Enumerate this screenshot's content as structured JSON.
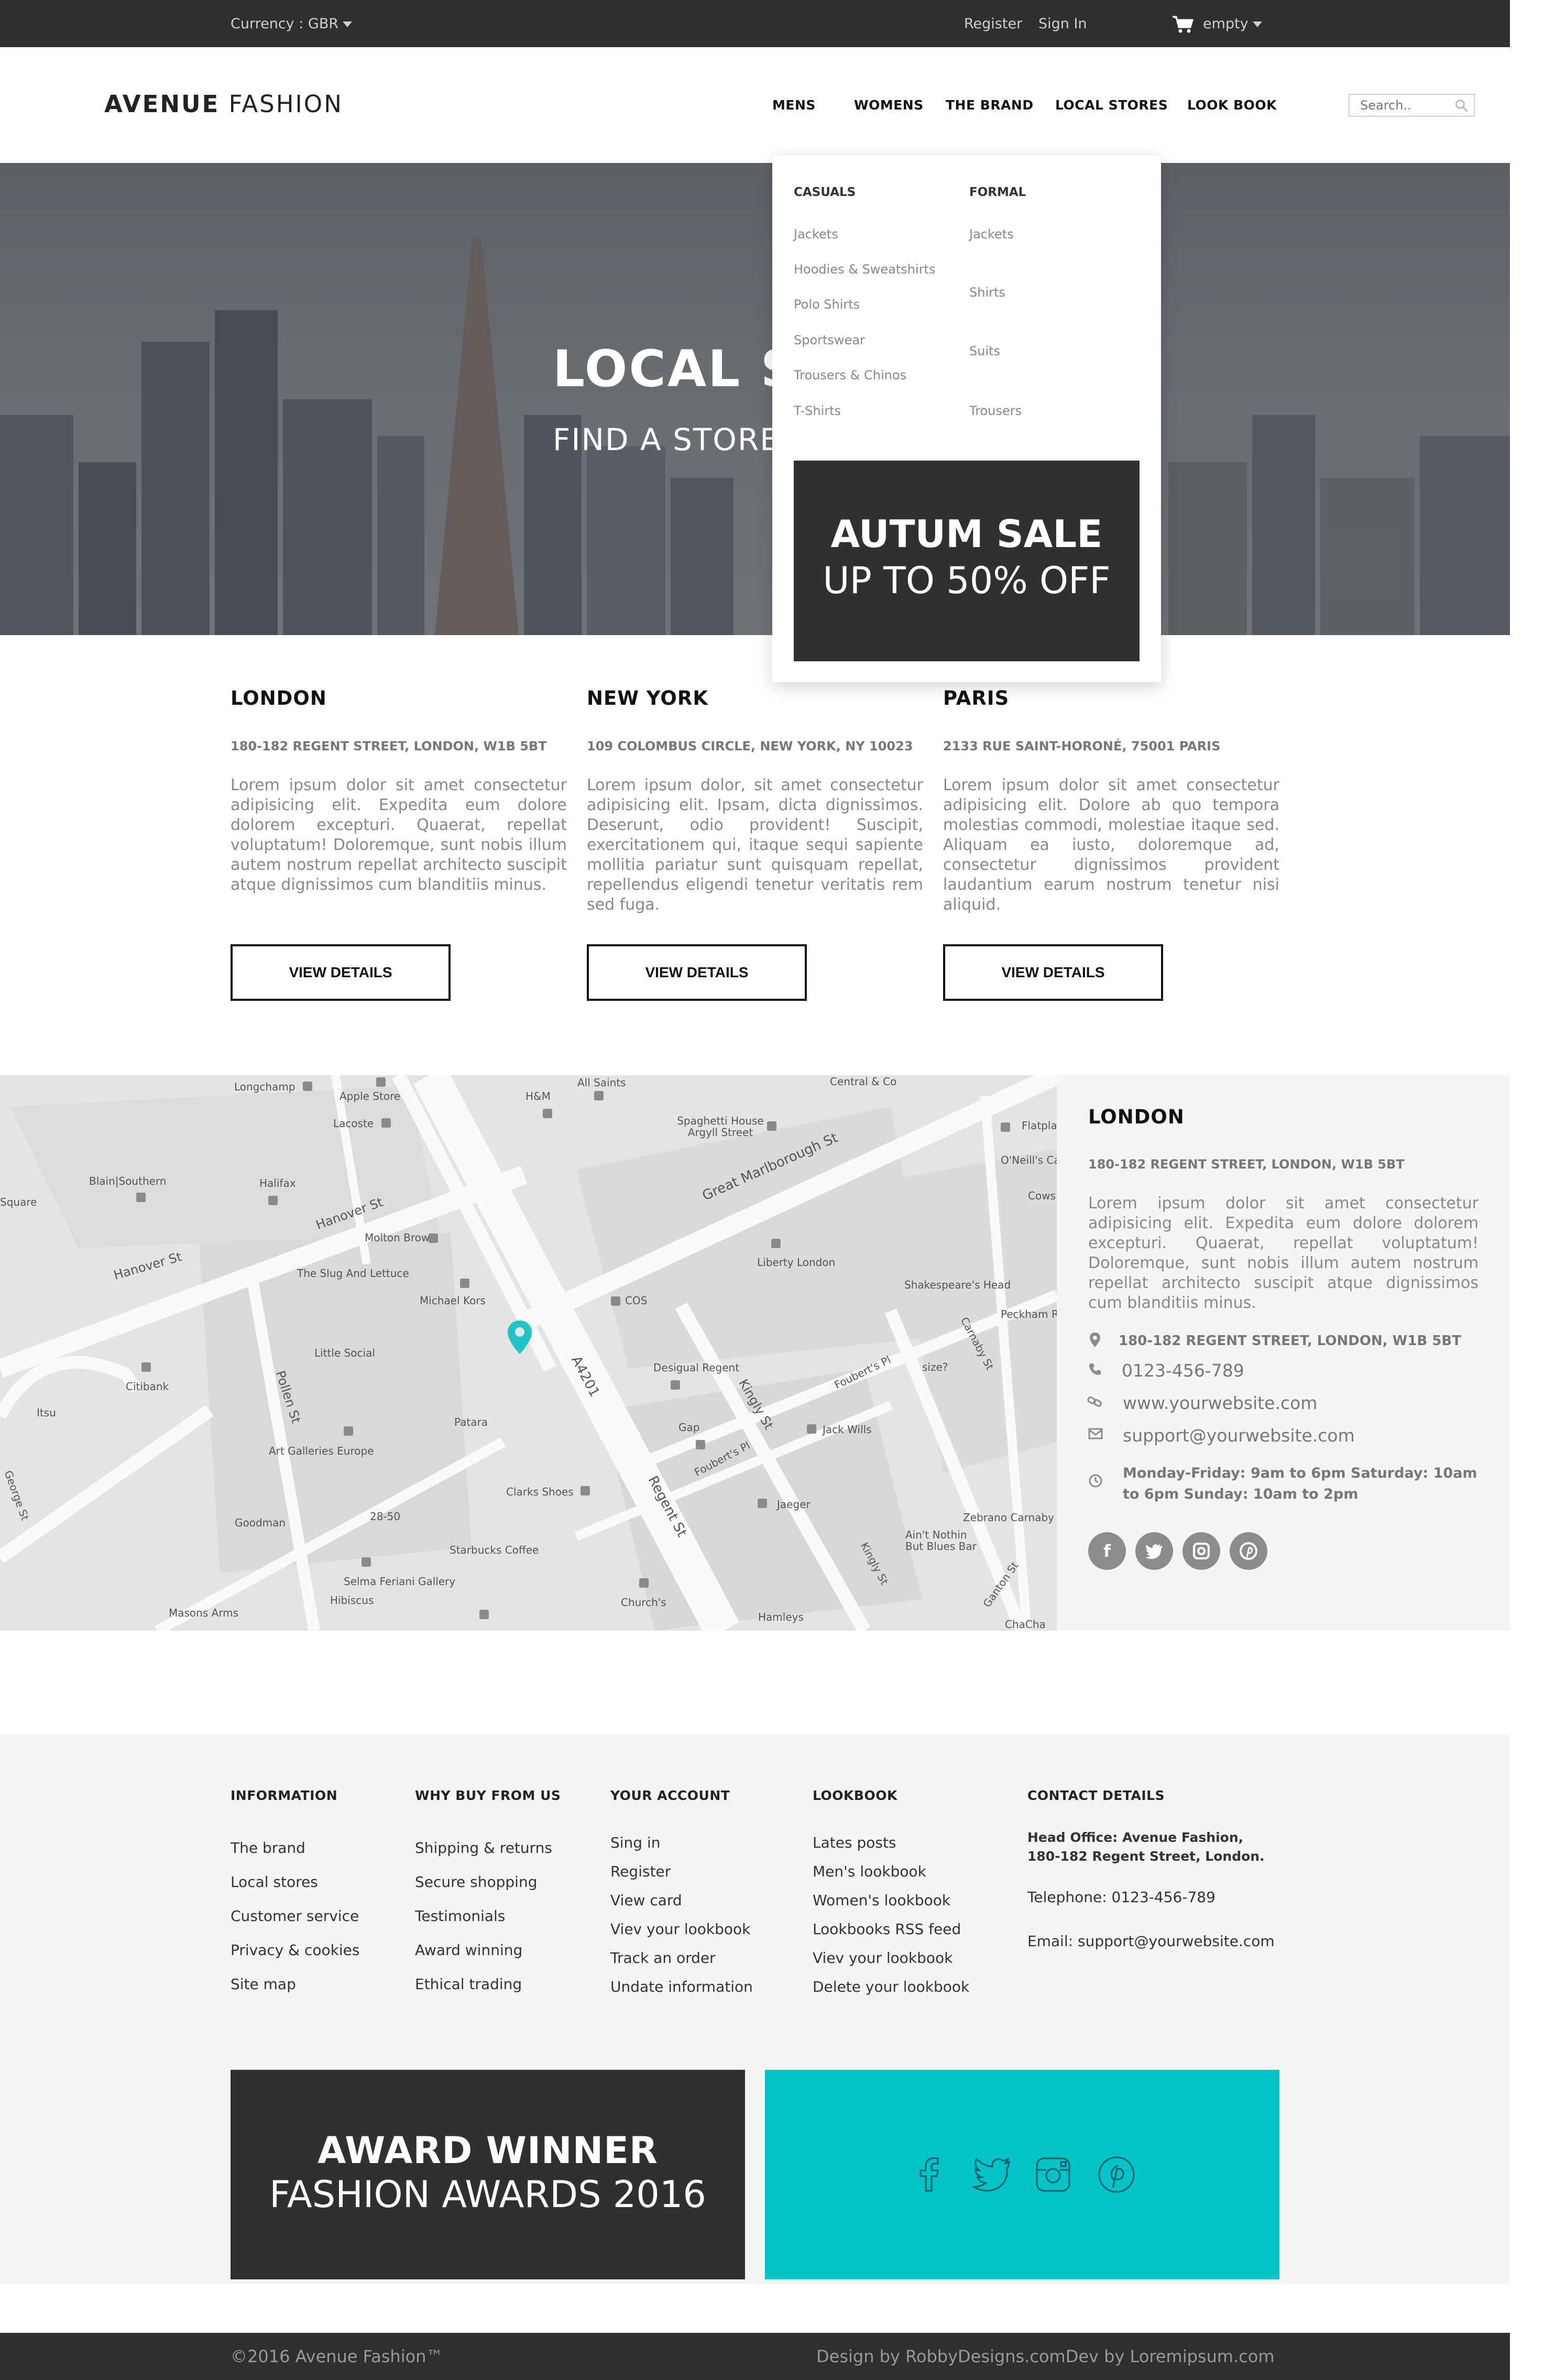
{
  "topbar": {
    "currency": "Currency : GBR",
    "register": "Register",
    "sign_in": "Sign In",
    "cart": "empty"
  },
  "header": {
    "logo_bold": "AVENUE",
    "logo_light": "FASHION",
    "nav": [
      "MENS",
      "WOMENS",
      "THE BRAND",
      "LOCAL STORES",
      "LOOK BOOK"
    ],
    "search_placeholder": "Search.."
  },
  "hero": {
    "title": "LOCAL S",
    "subtitle": "FIND A STORE"
  },
  "dropdown": {
    "casuals_heading": "CASUALS",
    "casuals": [
      "Jackets",
      "Hoodies & Sweatshirts",
      "Polo Shirts",
      "Sportswear",
      "Trousers & Chinos",
      "T-Shirts"
    ],
    "formal_heading": "FORMAL",
    "formal": [
      "Jackets",
      "Shirts",
      "Suits",
      "Trousers"
    ],
    "sale_line1": "AUTUM SALE",
    "sale_line2": "UP TO 50% OFF"
  },
  "stores": [
    {
      "name": "LONDON",
      "address": "180-182 REGENT STREET, LONDON, W1B 5BT",
      "description": "Lorem ipsum dolor sit amet consectetur adipisicing elit. Expedita eum dolore dolorem excepturi. Quaerat, repellat voluptatum! Doloremque, sunt nobis illum autem nostrum repellat architecto suscipit atque dignissimos cum blanditiis minus.",
      "button": "VIEW DETAILS"
    },
    {
      "name": "NEW YORK",
      "address": "109 COLOMBUS CIRCLE, NEW YORK, NY 10023",
      "description": "Lorem ipsum dolor, sit amet consectetur adipisicing elit. Ipsam, dicta dignissimos. Deserunt, odio provident! Suscipit, exercitationem qui, itaque sequi sapiente mollitia pariatur sunt quisquam repellat, repellendus eligendi tenetur veritatis rem sed fuga.",
      "button": "VIEW DETAILS"
    },
    {
      "name": "PARIS",
      "address": "2133 RUE SAINT-HORONÉ, 75001 PARIS",
      "description": "Lorem ipsum dolor sit amet consectetur adipisicing elit. Dolore ab quo tempora molestias commodi, molestiae itaque sed. Aliquam ea iusto, doloremque ad, consectetur dignissimos provident laudantium earum nostrum tenetur nisi aliquid.",
      "button": "VIEW DETAILS"
    }
  ],
  "map": {
    "labels": [
      "Longchamp",
      "Apple Store",
      "Lacoste",
      "H&M",
      "All Saints",
      "Spaghetti House Argyll Street",
      "Central & Co",
      "Great Marlborough St",
      "Flatplan",
      "O'Neill's Ca",
      "Blain|Southern",
      "Halifax",
      "Hanover St",
      "Hanover St",
      "Molton Brown",
      "The Slug And Lettuce",
      "Michael Kors",
      "Liberty London",
      "COS",
      "Shakespeare's Head",
      "Peckham R",
      "Little Social",
      "Citibank",
      "Itsu",
      "Pollen St",
      "A4201",
      "Desigual Regent",
      "Kingly St",
      "Foubert's Pl",
      "size?",
      "Carnaby St",
      "Patara",
      "Gap",
      "Jack Wills",
      "Art Galleries Europe",
      "Foubert's Pl",
      "Jaeger",
      "Zebrano Carnaby",
      "Clarks Shoes",
      "Regent St",
      "Goodman",
      "28-50",
      "Ain't Nothin But Blues Bar",
      "Starbucks Coffee",
      "Kingly St",
      "Selma Feriani Gallery",
      "Hibiscus",
      "Church's",
      "Masons Arms",
      "Hamleys",
      "Ganton St",
      "ChaCha",
      "Square",
      "Cows",
      "George St"
    ]
  },
  "map_info": {
    "city": "LONDON",
    "address": "180-182 REGENT STREET, LONDON, W1B 5BT",
    "description": "Lorem ipsum dolor sit amet consectetur adipisicing elit. Expedita eum dolore dolorem excepturi. Quaerat, repellat voluptatum! Doloremque, sunt nobis illum autem nostrum repellat architecto suscipit atque dignissimos cum blanditiis minus.",
    "contact_address": "180-182 REGENT STREET, LONDON, W1B 5BT",
    "phone": "0123-456-789",
    "website": "www.yourwebsite.com",
    "email": "support@yourwebsite.com",
    "hours": "Monday-Friday: 9am to 6pm Saturday: 10am to 6pm Sunday: 10am to 2pm"
  },
  "footer": {
    "columns": [
      {
        "heading": "INFORMATION",
        "links": [
          "The brand",
          "Local stores",
          "Customer service",
          "Privacy & cookies",
          "Site map"
        ]
      },
      {
        "heading": "WHY BUY FROM US",
        "links": [
          "Shipping & returns",
          "Secure shopping",
          "Testimonials",
          "Award winning",
          "Ethical trading"
        ]
      },
      {
        "heading": "YOUR ACCOUNT",
        "links": [
          "Sing in",
          "Register",
          "View card",
          "Viev your lookbook",
          "Track an order",
          "Undate information"
        ]
      },
      {
        "heading": "LOOKBOOK",
        "links": [
          "Lates posts",
          "Men's lookbook",
          "Women's lookbook",
          "Lookbooks RSS feed",
          "Viev your lookbook",
          "Delete your lookbook"
        ]
      }
    ],
    "contact": {
      "heading": "CONTACT DETAILS",
      "office_line1": "Head Office: Avenue Fashion,",
      "office_line2": "180-182 Regent Street, London.",
      "telephone": "Telephone: 0123-456-789",
      "email": "Email: support@yourwebsite.com"
    },
    "award_line1": "AWARD WINNER",
    "award_line2": "FASHION AWARDS 2016",
    "copyright": "©2016 Avenue Fashion™",
    "credits": "Design by RobbyDesigns.comDev by Loremipsum.com"
  },
  "colors": {
    "dark": "#2f2f2f",
    "accent_teal": "#00c4c8",
    "light_bg": "#f5f5f5",
    "map_pin": "#1fc4c8"
  }
}
